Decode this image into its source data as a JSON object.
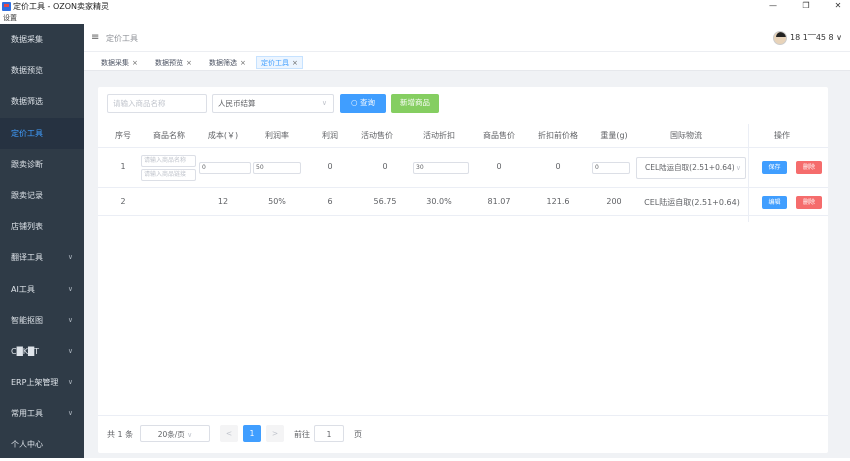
{
  "window": {
    "title": "定价工具 - OZON卖家精灵",
    "controls": [
      "—",
      "❐",
      "✕"
    ]
  },
  "menubar": {
    "settings": "设置"
  },
  "sidebar": {
    "items": [
      {
        "label": "数据采集"
      },
      {
        "label": "数据预览"
      },
      {
        "label": "数据筛选"
      },
      {
        "label": "定价工具",
        "active": true
      },
      {
        "label": "跟卖诊断"
      },
      {
        "label": "跟卖记录"
      },
      {
        "label": "店铺列表"
      },
      {
        "label": "翻译工具",
        "chevron": "∨"
      },
      {
        "label": "AI工具",
        "chevron": "∨"
      },
      {
        "label": "智能抠图",
        "chevron": "∨"
      },
      {
        "label": "C█K█T",
        "chevron": "∨"
      },
      {
        "label": "ERP上架管理",
        "chevron": "∨"
      },
      {
        "label": "常用工具",
        "chevron": "∨"
      },
      {
        "label": "个人中心"
      }
    ]
  },
  "header": {
    "menu_icon": "≡",
    "breadcrumb": "定价工具",
    "user": "18 1‾‾45 8 ∨"
  },
  "tags": [
    {
      "label": "数据采集",
      "close": "×"
    },
    {
      "label": "数据预览",
      "close": "×"
    },
    {
      "label": "数据筛选",
      "close": "×"
    },
    {
      "label": "定价工具",
      "close": "×",
      "active": true
    }
  ],
  "toolbar": {
    "search_placeholder": "请输入商品名称",
    "currency_select": "人民币结算",
    "select_arrow": "∨",
    "query_icon": "○",
    "query_label": "查询",
    "add_label": "新增商品"
  },
  "table": {
    "columns": [
      "序号",
      "商品名称",
      "成本(￥)",
      "利润率",
      "利润",
      "活动售价",
      "活动折扣",
      "商品售价",
      "折扣前价格",
      "重量(g)",
      "国际物流",
      "操作"
    ],
    "edit_row": {
      "index": "1",
      "name_placeholder": "请输入商品名称",
      "link_placeholder": "请输入商品链接",
      "cost": "0",
      "margin": "50",
      "profit": "0",
      "activity_price": "0",
      "activity_discount": "30",
      "price": "0",
      "pre_discount_price": "0",
      "weight": "0",
      "logistics": "CEL陆运自取(2.51+0.64)",
      "save": "保存",
      "delete": "删除"
    },
    "rows": [
      {
        "index": "2",
        "name": "",
        "cost": "12",
        "margin": "50%",
        "profit": "6",
        "activity_price": "56.75",
        "activity_discount": "30.0%",
        "price": "81.07",
        "pre_discount_price": "121.6",
        "weight": "200",
        "logistics": "CEL陆运自取(2.51+0.64)",
        "edit": "编辑",
        "delete": "删除"
      }
    ]
  },
  "pagination": {
    "total": "共 1 条",
    "page_size": "20条/页",
    "prev": "<",
    "current": "1",
    "next": ">",
    "goto": "前往",
    "goto_value": "1",
    "page_unit": "页"
  },
  "colors": {
    "sidebar_bg": "#2f3b47",
    "primary": "#409eff",
    "success": "#85ce61",
    "danger": "#f56c6c"
  }
}
